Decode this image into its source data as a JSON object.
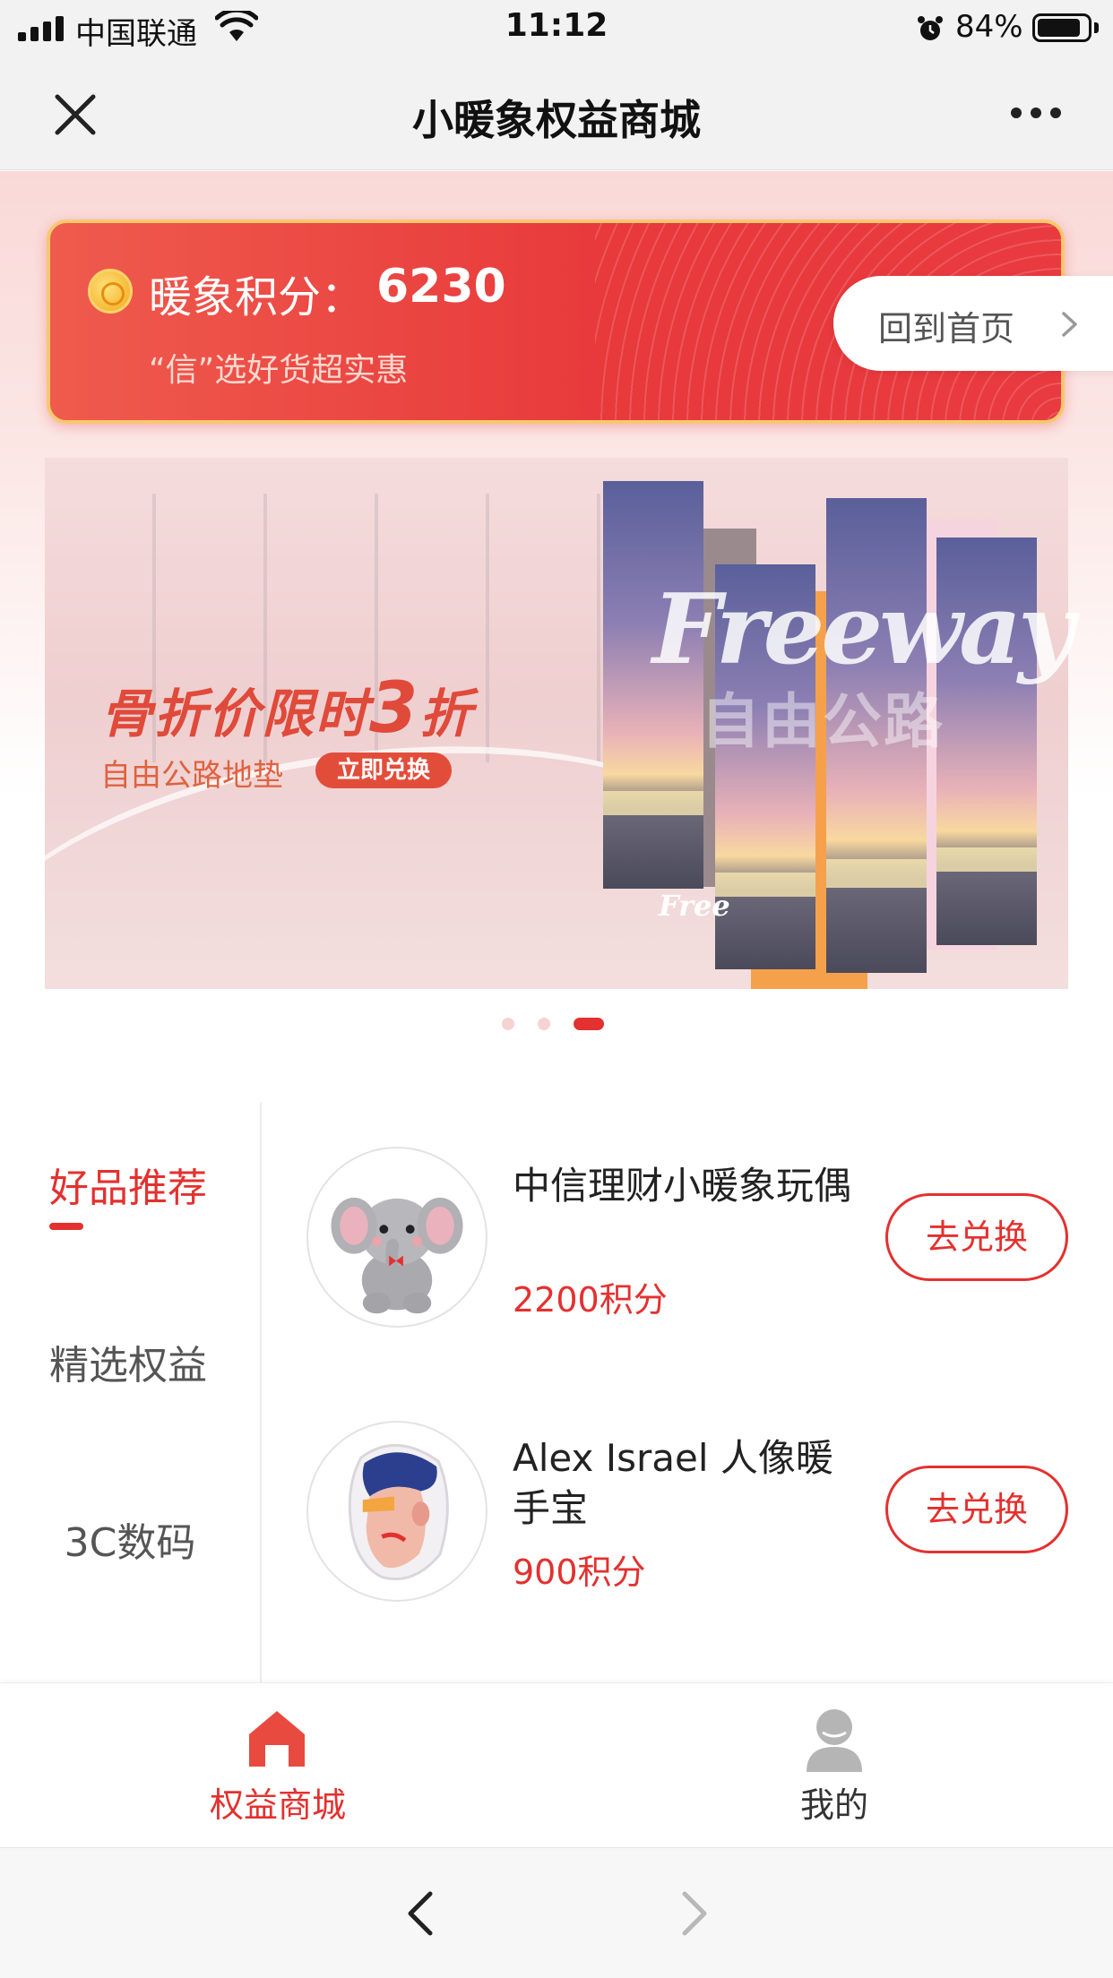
{
  "status_bar": {
    "carrier": "中国联通",
    "time": "11:12",
    "battery": "84%",
    "battery_level": 0.84,
    "icons": [
      "signal-icon",
      "wifi-icon",
      "alarm-icon",
      "battery-icon"
    ]
  },
  "nav": {
    "title": "小暖象权益商城",
    "icons": [
      "close-icon",
      "more-icon"
    ]
  },
  "points_card": {
    "label": "暖象积分：",
    "value": "6230",
    "subtitle": "“信”选好货超实惠",
    "home_button": "回到首页"
  },
  "banner": {
    "headline_pre": "骨折价限时",
    "headline_num": "3",
    "headline_post": "折",
    "subline": "自由公路地垫",
    "cta": "立即兑换",
    "script_text": "Freeway",
    "cn_overlay": "自由公路",
    "small_script": "Free",
    "slide_count": 3,
    "active_slide": 3
  },
  "categories": [
    {
      "label": "好品推荐",
      "active": true
    },
    {
      "label": "精选权益",
      "active": false
    },
    {
      "label": "3C数码",
      "active": false
    }
  ],
  "products": [
    {
      "name": "中信理财小暖象玩偶",
      "points": "2200积分",
      "button": "去兑换",
      "image_icon": "elephant-plush-image"
    },
    {
      "name": "Alex Israel 人像暖手宝",
      "points": "900积分",
      "button": "去兑换",
      "image_icon": "portrait-hand-warmer-image"
    }
  ],
  "tabbar": {
    "items": [
      {
        "label": "权益商城",
        "icon": "home-icon",
        "active": true
      },
      {
        "label": "我的",
        "icon": "user-icon",
        "active": false
      }
    ]
  },
  "browser": {
    "icons": [
      "back-icon",
      "forward-icon"
    ]
  },
  "colors": {
    "accent": "#e3312f",
    "card_gradient_start": "#ef5b4d",
    "card_border": "#f7c86e",
    "inactive_text": "#555555"
  }
}
